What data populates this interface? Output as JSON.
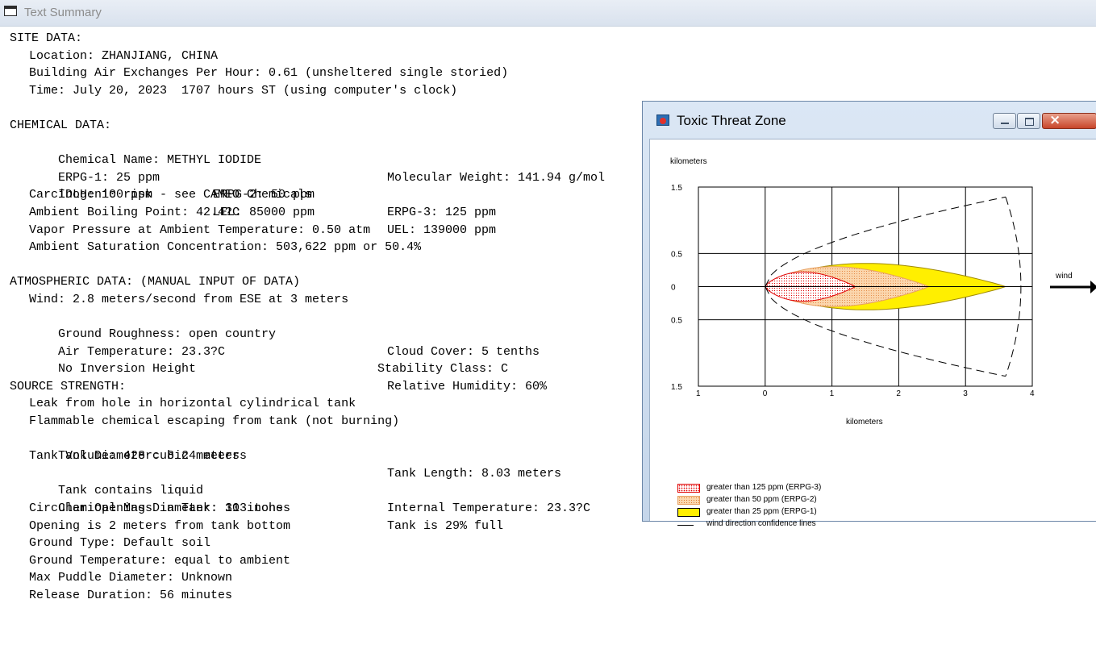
{
  "main_window": {
    "title": "Text Summary"
  },
  "summary": {
    "site": {
      "header": "SITE DATA:",
      "location": "Location: ZHANJIANG, CHINA",
      "air_exchanges": "Building Air Exchanges Per Hour: 0.61 (unsheltered single storied)",
      "time": "Time: July 20, 2023  1707 hours ST (using computer's clock)"
    },
    "chemical": {
      "header": "CHEMICAL DATA:",
      "name": "Chemical Name: METHYL IODIDE",
      "molecular_weight": "Molecular Weight: 141.94 g/mol",
      "erpg1": "ERPG-1: 25 ppm",
      "erpg2": "ERPG-2: 50 ppm",
      "erpg3": "ERPG-3: 125 ppm",
      "idlh": "IDLH: 100 ppm",
      "lel": "LEL: 85000 ppm",
      "uel": "UEL: 139000 ppm",
      "carcinogenic": "Carcinogenic risk - see CAMEO Chemicals",
      "boiling_point": "Ambient Boiling Point: 42.4?C",
      "vapor_pressure": "Vapor Pressure at Ambient Temperature: 0.50 atm",
      "saturation": "Ambient Saturation Concentration: 503,622 ppm or 50.4%"
    },
    "atmospheric": {
      "header": "ATMOSPHERIC DATA: (MANUAL INPUT OF DATA)",
      "wind": "Wind: 2.8 meters/second from ESE at 3 meters",
      "roughness": "Ground Roughness: open country",
      "cloud": "Cloud Cover: 5 tenths",
      "air_temp": "Air Temperature: 23.3?C",
      "stability": "Stability Class: C",
      "inversion": "No Inversion Height",
      "humidity": "Relative Humidity: 60%"
    },
    "source": {
      "header": "SOURCE STRENGTH:",
      "leak": "Leak from hole in horizontal cylindrical tank",
      "flammable": "Flammable chemical escaping from tank (not burning)",
      "diameter": "Tank Diameter: 8.24 meters",
      "length": "Tank Length: 8.03 meters",
      "volume": "Tank Volume: 428 cubic meters",
      "contains": "Tank contains liquid",
      "internal_temp": "Internal Temperature: 23.3?C",
      "mass": "Chemical Mass in Tank: 313 tons",
      "full": "Tank is 29% full",
      "opening_diameter": "Circular Opening Diameter: 10 inches",
      "opening_position": "Opening is 2 meters from tank bottom",
      "ground_type": "Ground Type: Default soil",
      "ground_temp": "Ground Temperature: equal to ambient",
      "puddle": "Max Puddle Diameter: Unknown",
      "duration": "Release Duration: 56 minutes"
    }
  },
  "threat_window": {
    "title": "Toxic Threat Zone",
    "y_unit": "kilometers",
    "x_unit": "kilometers",
    "wind_label": "wind",
    "legend": [
      {
        "label": "greater than 125 ppm (ERPG-3)",
        "color": "#e00000"
      },
      {
        "label": "greater than 50 ppm (ERPG-2)",
        "color": "#f4b27a"
      },
      {
        "label": "greater than 25 ppm (ERPG-1)",
        "color": "#ffef00"
      },
      {
        "label": "wind direction confidence lines",
        "color": "#000000"
      }
    ]
  },
  "chart_data": {
    "type": "area",
    "x_ticks": [
      "1",
      "0",
      "1",
      "2",
      "3",
      "4"
    ],
    "y_ticks": [
      "1.5",
      "0.5",
      "0",
      "0.5",
      "1.5"
    ],
    "xlim": [
      -1,
      4
    ],
    "ylim": [
      -1.5,
      1.5
    ],
    "grid": true,
    "zones": [
      {
        "name": "greater than 25 ppm (ERPG-1)",
        "x_start": 0,
        "x_end": 3.6,
        "max_half_width": 0.35,
        "color": "#ffef00"
      },
      {
        "name": "greater than 50 ppm (ERPG-2)",
        "x_start": 0,
        "x_end": 2.45,
        "max_half_width": 0.3,
        "color": "#f4b27a"
      },
      {
        "name": "greater than 125 ppm (ERPG-3)",
        "x_start": 0,
        "x_end": 1.35,
        "max_half_width": 0.22,
        "color": "#e00000"
      }
    ],
    "confidence_lines": {
      "x_start": 0,
      "x_end": 3.6,
      "max_half_width": 1.35
    }
  }
}
